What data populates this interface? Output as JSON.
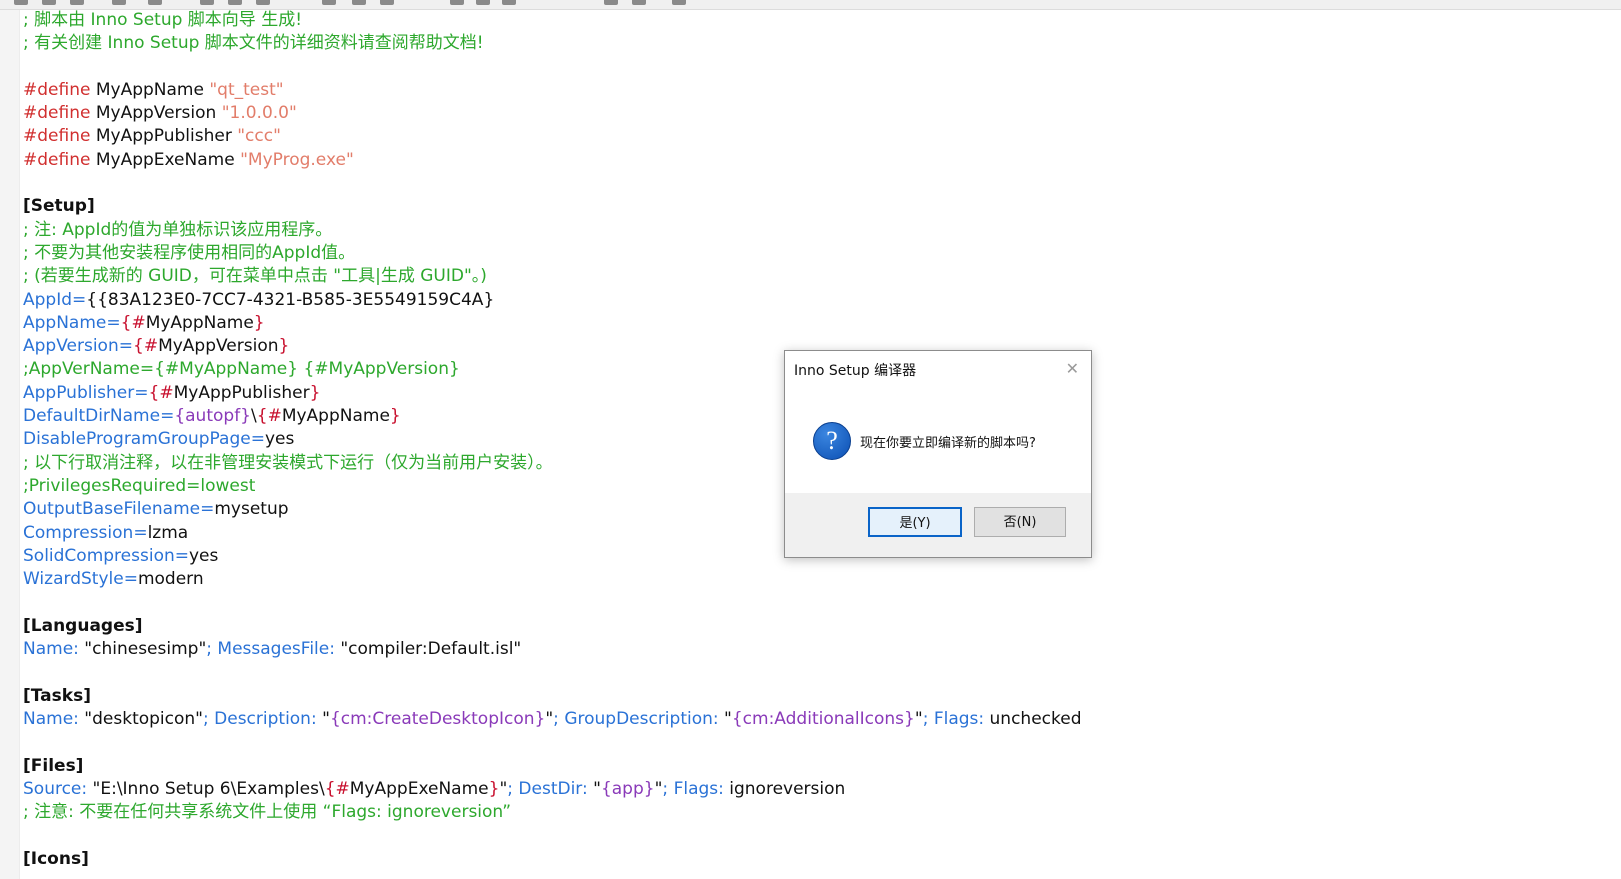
{
  "window": {
    "toolbar_icon_count": 12
  },
  "editor": {
    "lines": [
      [
        {
          "t": "; 脚本由 Inno Setup 脚本向导 生成!",
          "c": "comment"
        }
      ],
      [
        {
          "t": "; 有关创建 Inno Setup 脚本文件的详细资料请查阅帮助文档!",
          "c": "comment"
        }
      ],
      [],
      [
        {
          "t": "#define",
          "c": "directive"
        },
        {
          "t": " MyAppName ",
          "c": ""
        },
        {
          "t": "\"qt_test\"",
          "c": "string"
        }
      ],
      [
        {
          "t": "#define",
          "c": "directive"
        },
        {
          "t": " MyAppVersion ",
          "c": ""
        },
        {
          "t": "\"1.0.0.0\"",
          "c": "string"
        }
      ],
      [
        {
          "t": "#define",
          "c": "directive"
        },
        {
          "t": " MyAppPublisher ",
          "c": ""
        },
        {
          "t": "\"ccc\"",
          "c": "string"
        }
      ],
      [
        {
          "t": "#define",
          "c": "directive"
        },
        {
          "t": " MyAppExeName ",
          "c": ""
        },
        {
          "t": "\"MyProg.exe\"",
          "c": "string"
        }
      ],
      [],
      [
        {
          "t": "[Setup]",
          "c": "section"
        }
      ],
      [
        {
          "t": "; 注: AppId的值为单独标识该应用程序。",
          "c": "comment"
        }
      ],
      [
        {
          "t": "; 不要为其他安装程序使用相同的AppId值。",
          "c": "comment"
        }
      ],
      [
        {
          "t": "; (若要生成新的 GUID，可在菜单中点击 \"工具|生成 GUID\"。)",
          "c": "comment"
        }
      ],
      [
        {
          "t": "AppId",
          "c": "key"
        },
        {
          "t": "=",
          "c": "sym"
        },
        {
          "t": "{{83A123E0-7CC7-4321-B585-3E5549159C4A}",
          "c": ""
        }
      ],
      [
        {
          "t": "AppName",
          "c": "key"
        },
        {
          "t": "=",
          "c": "sym"
        },
        {
          "t": "{",
          "c": "brace"
        },
        {
          "t": "#",
          "c": "brace"
        },
        {
          "t": "MyAppName",
          "c": ""
        },
        {
          "t": "}",
          "c": "brace"
        }
      ],
      [
        {
          "t": "AppVersion",
          "c": "key"
        },
        {
          "t": "=",
          "c": "sym"
        },
        {
          "t": "{",
          "c": "brace"
        },
        {
          "t": "#",
          "c": "brace"
        },
        {
          "t": "MyAppVersion",
          "c": ""
        },
        {
          "t": "}",
          "c": "brace"
        }
      ],
      [
        {
          "t": ";AppVerName={#MyAppName} {#MyAppVersion}",
          "c": "comment"
        }
      ],
      [
        {
          "t": "AppPublisher",
          "c": "key"
        },
        {
          "t": "=",
          "c": "sym"
        },
        {
          "t": "{",
          "c": "brace"
        },
        {
          "t": "#",
          "c": "brace"
        },
        {
          "t": "MyAppPublisher",
          "c": ""
        },
        {
          "t": "}",
          "c": "brace"
        }
      ],
      [
        {
          "t": "DefaultDirName",
          "c": "key"
        },
        {
          "t": "=",
          "c": "sym"
        },
        {
          "t": "{autopf}",
          "c": "const"
        },
        {
          "t": "\\",
          "c": ""
        },
        {
          "t": "{",
          "c": "brace"
        },
        {
          "t": "#",
          "c": "brace"
        },
        {
          "t": "MyAppName",
          "c": ""
        },
        {
          "t": "}",
          "c": "brace"
        }
      ],
      [
        {
          "t": "DisableProgramGroupPage",
          "c": "key"
        },
        {
          "t": "=",
          "c": "sym"
        },
        {
          "t": "yes",
          "c": ""
        }
      ],
      [
        {
          "t": "; 以下行取消注释，以在非管理安装模式下运行（仅为当前用户安装）。",
          "c": "comment"
        }
      ],
      [
        {
          "t": ";PrivilegesRequired=lowest",
          "c": "comment"
        }
      ],
      [
        {
          "t": "OutputBaseFilename",
          "c": "key"
        },
        {
          "t": "=",
          "c": "sym"
        },
        {
          "t": "mysetup",
          "c": ""
        }
      ],
      [
        {
          "t": "Compression",
          "c": "key"
        },
        {
          "t": "=",
          "c": "sym"
        },
        {
          "t": "lzma",
          "c": ""
        }
      ],
      [
        {
          "t": "SolidCompression",
          "c": "key"
        },
        {
          "t": "=",
          "c": "sym"
        },
        {
          "t": "yes",
          "c": ""
        }
      ],
      [
        {
          "t": "WizardStyle",
          "c": "key"
        },
        {
          "t": "=",
          "c": "sym"
        },
        {
          "t": "modern",
          "c": ""
        }
      ],
      [],
      [
        {
          "t": "[Languages]",
          "c": "section"
        }
      ],
      [
        {
          "t": "Name:",
          "c": "key"
        },
        {
          "t": " \"chinesesimp\"",
          "c": ""
        },
        {
          "t": "; ",
          "c": "sym"
        },
        {
          "t": "MessagesFile:",
          "c": "key"
        },
        {
          "t": " \"compiler:Default.isl\"",
          "c": ""
        }
      ],
      [],
      [
        {
          "t": "[Tasks]",
          "c": "section"
        }
      ],
      [
        {
          "t": "Name:",
          "c": "key"
        },
        {
          "t": " \"desktopicon\"",
          "c": ""
        },
        {
          "t": "; ",
          "c": "sym"
        },
        {
          "t": "Description:",
          "c": "key"
        },
        {
          "t": " \"",
          "c": ""
        },
        {
          "t": "{cm:CreateDesktopIcon}",
          "c": "const"
        },
        {
          "t": "\"",
          "c": ""
        },
        {
          "t": "; ",
          "c": "sym"
        },
        {
          "t": "GroupDescription:",
          "c": "key"
        },
        {
          "t": " \"",
          "c": ""
        },
        {
          "t": "{cm:AdditionalIcons}",
          "c": "const"
        },
        {
          "t": "\"",
          "c": ""
        },
        {
          "t": "; ",
          "c": "sym"
        },
        {
          "t": "Flags:",
          "c": "key"
        },
        {
          "t": " unchecked",
          "c": ""
        }
      ],
      [],
      [
        {
          "t": "[Files]",
          "c": "section"
        }
      ],
      [
        {
          "t": "Source:",
          "c": "key"
        },
        {
          "t": " \"E:\\Inno Setup 6\\Examples\\",
          "c": ""
        },
        {
          "t": "{",
          "c": "brace"
        },
        {
          "t": "#",
          "c": "brace"
        },
        {
          "t": "MyAppExeName",
          "c": ""
        },
        {
          "t": "}",
          "c": "brace"
        },
        {
          "t": "\"",
          "c": ""
        },
        {
          "t": "; ",
          "c": "sym"
        },
        {
          "t": "DestDir:",
          "c": "key"
        },
        {
          "t": " \"",
          "c": ""
        },
        {
          "t": "{app}",
          "c": "const"
        },
        {
          "t": "\"",
          "c": ""
        },
        {
          "t": "; ",
          "c": "sym"
        },
        {
          "t": "Flags:",
          "c": "key"
        },
        {
          "t": " ignoreversion",
          "c": ""
        }
      ],
      [
        {
          "t": "; 注意: 不要在任何共享系统文件上使用 “Flags: ignoreversion”",
          "c": "comment"
        }
      ],
      [],
      [
        {
          "t": "[Icons]",
          "c": "section"
        }
      ]
    ]
  },
  "dialog": {
    "title": "Inno Setup 编译器",
    "close_glyph": "✕",
    "icon": "question-icon",
    "icon_glyph": "?",
    "message": "现在你要立即编译新的脚本吗?",
    "yes_label": "是(Y)",
    "no_label": "否(N)"
  }
}
